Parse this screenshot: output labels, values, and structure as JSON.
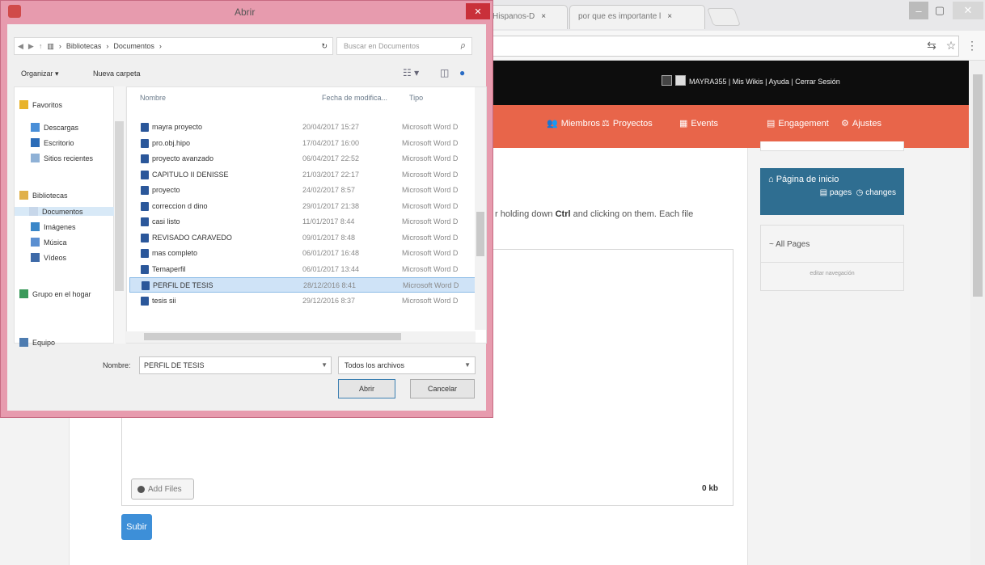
{
  "browser": {
    "tabs": [
      {
        "label": "Hispanos-D"
      },
      {
        "label": "por que es importante l"
      }
    ],
    "tab_close": "×",
    "window_controls": {
      "minimize": "–",
      "maximize": "▢",
      "close": "✕"
    },
    "toolbar_icons": {
      "translate": "⇆",
      "star": "☆",
      "menu": "⋮"
    }
  },
  "site": {
    "user_links": "MAYRA355 | Mis Wikis | Ayuda | Cerrar Sesión",
    "nav": [
      {
        "label": "Miembros",
        "icon": "members-icon",
        "glyph": "👥"
      },
      {
        "label": "Proyectos",
        "icon": "projects-icon",
        "glyph": "⚖"
      },
      {
        "label": "Events",
        "icon": "events-icon",
        "glyph": "▦"
      },
      {
        "label": "Engagement",
        "icon": "engagement-icon",
        "glyph": "▤"
      },
      {
        "label": "Ajustes",
        "icon": "gear-icon",
        "glyph": "⚙"
      }
    ],
    "hint_prefix": "r holding down ",
    "hint_key": "Ctrl",
    "hint_suffix": " and clicking on them. Each file",
    "add_files_label": "Add Files",
    "size_label": "0 kb",
    "submit_label": "Subir",
    "home_card": {
      "title": "Página de inicio",
      "pages": "pages",
      "changes": "changes"
    },
    "pages_card": {
      "all_pages": "~ All Pages",
      "edit_nav": "editar navegación"
    }
  },
  "dialog": {
    "title": "Abrir",
    "close_glyph": "✕",
    "breadcrumb": [
      "Bibliotecas",
      "Documentos"
    ],
    "breadcrumb_sep": "›",
    "refresh_glyph": "↻",
    "search_placeholder": "Buscar en Documentos",
    "search_glyph": "ρ",
    "organize_label": "Organizar ▾",
    "new_folder_label": "Nueva carpeta",
    "view_glyphs": {
      "view": "☷ ▾",
      "preview": "◫",
      "help": "●"
    },
    "columns": {
      "name": "Nombre",
      "date": "Fecha de modifica...",
      "type": "Tipo"
    },
    "nav_tree": [
      {
        "label": "Favoritos",
        "icon": "star-icon",
        "color": "#e8b32a",
        "indent": 0
      },
      {
        "label": "Descargas",
        "icon": "downloads-icon",
        "color": "#4a8fd8",
        "indent": 1
      },
      {
        "label": "Escritorio",
        "icon": "desktop-icon",
        "color": "#2b6cb8",
        "indent": 1
      },
      {
        "label": "Sitios recientes",
        "icon": "recent-places-icon",
        "color": "#8fb1d6",
        "indent": 1
      },
      {
        "label": "Bibliotecas",
        "icon": "libraries-icon",
        "color": "#e0b04a",
        "indent": 0
      },
      {
        "label": "Documentos",
        "icon": "documents-icon",
        "color": "#c7d7ea",
        "indent": 1,
        "selected": true
      },
      {
        "label": "Imágenes",
        "icon": "pictures-icon",
        "color": "#3a86c8",
        "indent": 1
      },
      {
        "label": "Música",
        "icon": "music-icon",
        "color": "#5b8fd1",
        "indent": 1
      },
      {
        "label": "Vídeos",
        "icon": "videos-icon",
        "color": "#3e6aa8",
        "indent": 1
      },
      {
        "label": "Grupo en el hogar",
        "icon": "homegroup-icon",
        "color": "#3a9a5a",
        "indent": 0
      },
      {
        "label": "Equipo",
        "icon": "computer-icon",
        "color": "#4e7cb0",
        "indent": 0
      }
    ],
    "files": [
      {
        "name": "mayra proyecto",
        "date": "20/04/2017 15:27",
        "type": "Microsoft Word D"
      },
      {
        "name": "pro.obj.hipo",
        "date": "17/04/2017 16:00",
        "type": "Microsoft Word D"
      },
      {
        "name": "proyecto avanzado",
        "date": "06/04/2017 22:52",
        "type": "Microsoft Word D"
      },
      {
        "name": "CAPITULO II DENISSE",
        "date": "21/03/2017 22:17",
        "type": "Microsoft Word D"
      },
      {
        "name": "proyecto",
        "date": "24/02/2017 8:57",
        "type": "Microsoft Word D"
      },
      {
        "name": "correccion d dino",
        "date": "29/01/2017 21:38",
        "type": "Microsoft Word D"
      },
      {
        "name": "casi listo",
        "date": "11/01/2017 8:44",
        "type": "Microsoft Word D"
      },
      {
        "name": "REVISADO CARAVEDO",
        "date": "09/01/2017 8:48",
        "type": "Microsoft Word D"
      },
      {
        "name": "mas completo",
        "date": "06/01/2017 16:48",
        "type": "Microsoft Word D"
      },
      {
        "name": "Temaperfil",
        "date": "06/01/2017 13:44",
        "type": "Microsoft Word D"
      },
      {
        "name": "PERFIL DE TESIS",
        "date": "28/12/2016 8:41",
        "type": "Microsoft Word D",
        "selected": true
      },
      {
        "name": "tesis sii",
        "date": "29/12/2016 8:37",
        "type": "Microsoft Word D"
      }
    ],
    "name_label": "Nombre:",
    "name_value": "PERFIL DE TESIS",
    "type_value": "Todos los archivos",
    "open_label": "Abrir",
    "cancel_label": "Cancelar",
    "colors": {
      "frame": "#e79bae",
      "close": "#c9303a",
      "selected_row": "#cfe3f7"
    }
  }
}
